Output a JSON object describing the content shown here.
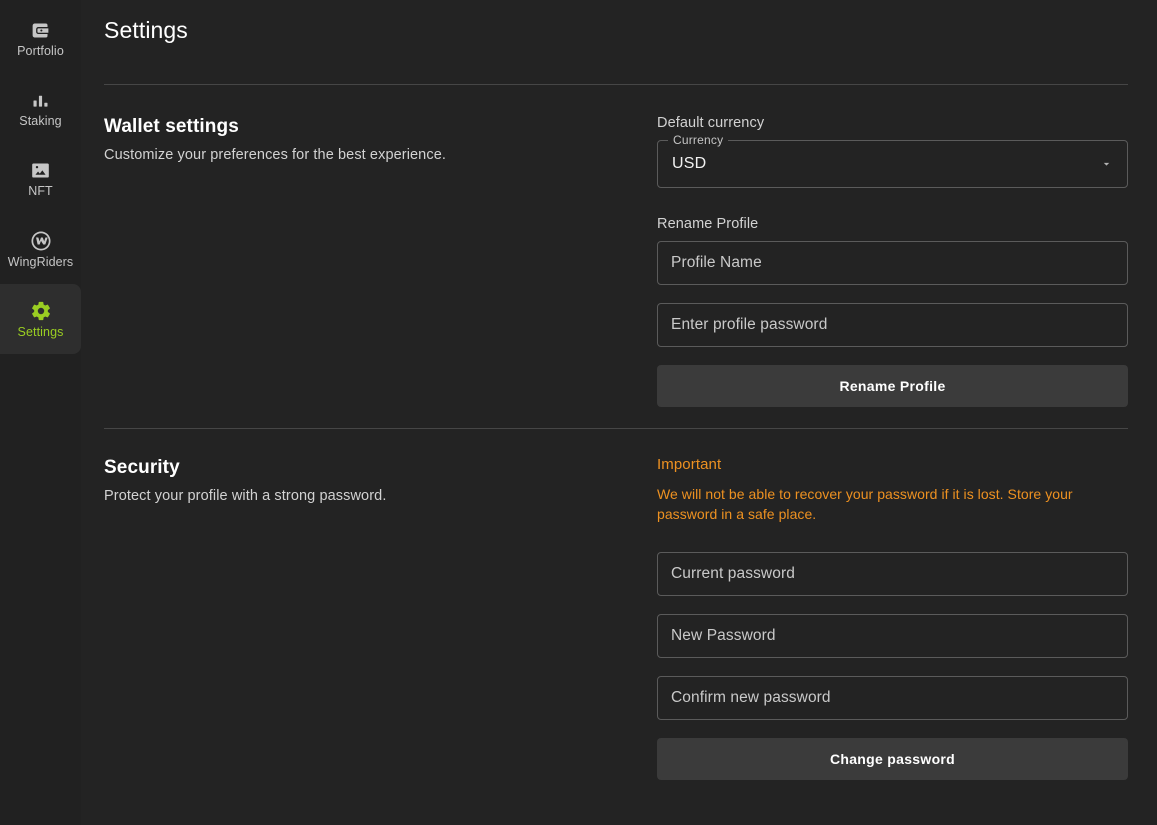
{
  "sidebar": {
    "items": [
      {
        "label": "Portfolio",
        "icon": "wallet-icon",
        "active": false
      },
      {
        "label": "Staking",
        "icon": "bar-chart-icon",
        "active": false
      },
      {
        "label": "NFT",
        "icon": "image-icon",
        "active": false
      },
      {
        "label": "WingRiders",
        "icon": "wingriders-icon",
        "active": false
      },
      {
        "label": "Settings",
        "icon": "gear-icon",
        "active": true
      }
    ],
    "active_color": "#9ace22",
    "active_bg": "#2e2e2e",
    "inactive_color": "#c6c6c6"
  },
  "header": {
    "title": "Settings"
  },
  "wallet_settings": {
    "heading": "Wallet settings",
    "subheading": "Customize your preferences for the best experience.",
    "currency": {
      "label": "Default currency",
      "legend": "Currency",
      "value": "USD",
      "arrow_icon": "chevron-down-icon"
    },
    "rename": {
      "label": "Rename Profile",
      "name_placeholder": "Profile Name",
      "name_value": "",
      "password_placeholder": "Enter profile password",
      "password_value": "",
      "button_label": "Rename Profile"
    }
  },
  "security": {
    "heading": "Security",
    "subheading": "Protect your profile with a strong password.",
    "warning": {
      "title": "Important",
      "body": "We will not be able to recover your password if it is lost. Store your password in a safe place.",
      "color": "#ed9121"
    },
    "current_password_placeholder": "Current password",
    "current_password_value": "",
    "new_password_placeholder": "New Password",
    "new_password_value": "",
    "confirm_password_placeholder": "Confirm new password",
    "confirm_password_value": "",
    "button_label": "Change password"
  }
}
